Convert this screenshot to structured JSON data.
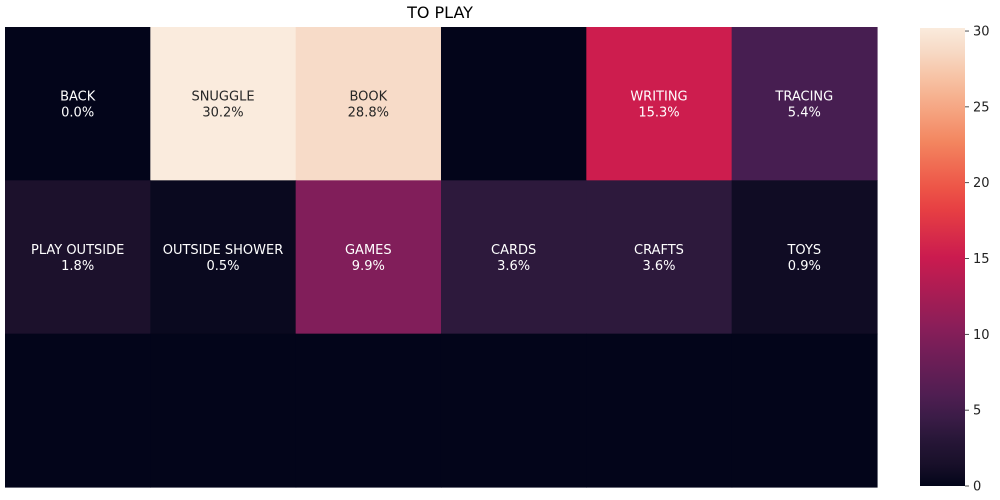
{
  "chart_data": {
    "type": "heatmap",
    "title": "TO PLAY",
    "colormap": "rocket",
    "vmin": 0,
    "vmax": 30.2,
    "colorbar_ticks": [
      0,
      5,
      10,
      15,
      20,
      25,
      30
    ],
    "colorbar_tick_labels": [
      "0",
      "5",
      "10",
      "15",
      "20",
      "25",
      "30"
    ],
    "rows": [
      [
        {
          "label": "BACK",
          "value": 0.0,
          "value_text": "0.0%"
        },
        {
          "label": "SNUGGLE",
          "value": 30.2,
          "value_text": "30.2%"
        },
        {
          "label": "BOOK",
          "value": 28.8,
          "value_text": "28.8%"
        },
        {
          "label": "",
          "value": 0.0,
          "value_text": ""
        },
        {
          "label": "WRITING",
          "value": 15.3,
          "value_text": "15.3%"
        },
        {
          "label": "TRACING",
          "value": 5.4,
          "value_text": "5.4%"
        }
      ],
      [
        {
          "label": "PLAY OUTSIDE",
          "value": 1.8,
          "value_text": "1.8%"
        },
        {
          "label": "OUTSIDE SHOWER",
          "value": 0.5,
          "value_text": "0.5%"
        },
        {
          "label": "GAMES",
          "value": 9.9,
          "value_text": "9.9%"
        },
        {
          "label": "CARDS",
          "value": 3.6,
          "value_text": "3.6%"
        },
        {
          "label": "CRAFTS",
          "value": 3.6,
          "value_text": "3.6%"
        },
        {
          "label": "TOYS",
          "value": 0.9,
          "value_text": "0.9%"
        }
      ],
      [
        {
          "label": "",
          "value": 0.0,
          "value_text": ""
        },
        {
          "label": "",
          "value": 0.0,
          "value_text": ""
        },
        {
          "label": "",
          "value": 0.0,
          "value_text": ""
        },
        {
          "label": "",
          "value": 0.0,
          "value_text": ""
        },
        {
          "label": "",
          "value": 0.0,
          "value_text": ""
        },
        {
          "label": "",
          "value": 0.0,
          "value_text": ""
        }
      ]
    ]
  }
}
